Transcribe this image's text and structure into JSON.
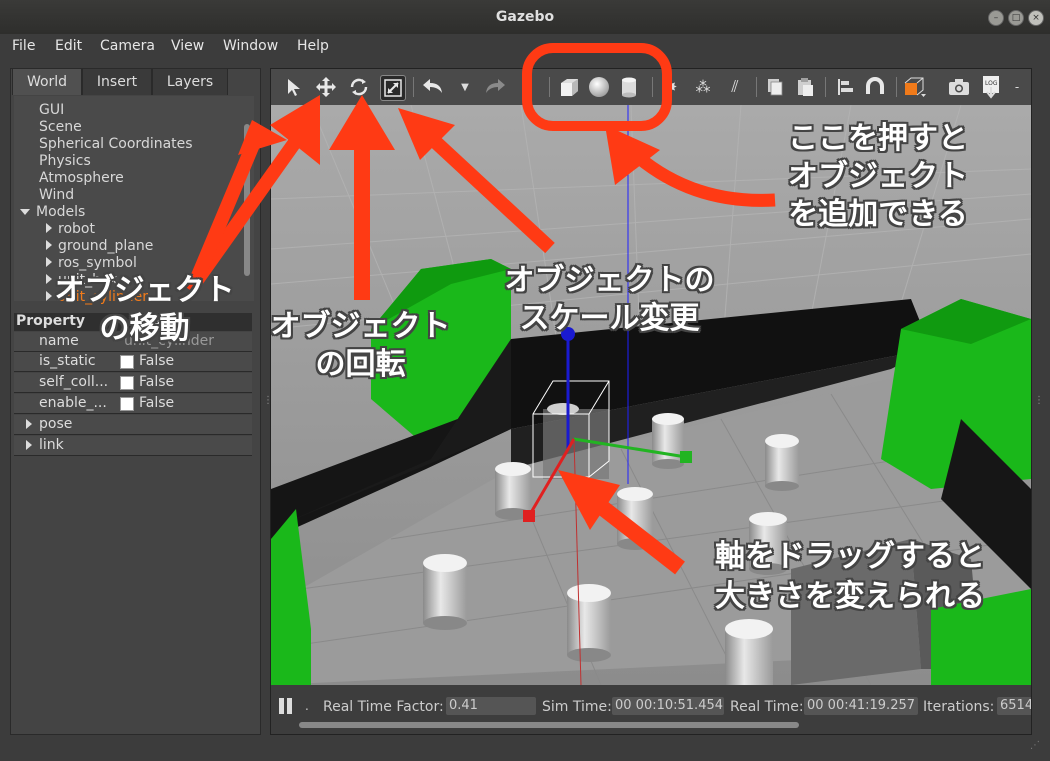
{
  "window": {
    "title": "Gazebo"
  },
  "menu": [
    "File",
    "Edit",
    "Camera",
    "View",
    "Window",
    "Help"
  ],
  "tabs": [
    "World",
    "Insert",
    "Layers"
  ],
  "tree": {
    "items": [
      "GUI",
      "Scene",
      "Spherical Coordinates",
      "Physics",
      "Atmosphere",
      "Wind"
    ],
    "models_label": "Models",
    "models": [
      "robot",
      "ground_plane",
      "ros_symbol",
      "unit_box",
      "unit_cylinder"
    ]
  },
  "properties": {
    "header": "Property",
    "header_value": "Value",
    "rows": [
      {
        "key": "name",
        "value": "unit_cylinder"
      },
      {
        "key": "is_static",
        "value": "False"
      },
      {
        "key": "self_coll...",
        "value": "False"
      },
      {
        "key": "enable_...",
        "value": "False"
      }
    ],
    "groups": [
      "pose",
      "link"
    ]
  },
  "status": {
    "rtf_label": "Real Time Factor:",
    "rtf": "0.41",
    "sim_label": "Sim Time:",
    "sim": "00 00:10:51.454",
    "real_label": "Real Time:",
    "real": "00 00:41:19.257",
    "iter_label": "Iterations:",
    "iter": "6514"
  },
  "toolbar_icons": [
    "select-arrow",
    "translate",
    "rotate",
    "scale",
    "undo",
    "undo-menu",
    "redo",
    "box",
    "sphere",
    "cylinder",
    "point-light",
    "spot-light",
    "directional-light",
    "copy",
    "paste",
    "align",
    "snap",
    "view-angle",
    "screenshot",
    "log"
  ],
  "annotations": {
    "add_object": "ここを押すと\nオブジェクト\nを追加できる",
    "move": "オブジェクト\nの移動",
    "rotate": "オブジェクト\nの回転",
    "scale": "オブジェクトの\nスケール変更",
    "axis_line1": "軸をドラッグすると",
    "axis_line2": "大きさを変えられる"
  },
  "colors": {
    "annotation_red": "#ff3a14",
    "green": "#19c419",
    "accent_orange": "#f07a1a"
  }
}
